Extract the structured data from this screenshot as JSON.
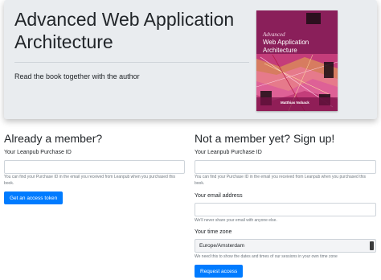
{
  "hero": {
    "title": "Advanced Web Application Architecture",
    "lead": "Read the book together with the author"
  },
  "cover": {
    "title_line1": "Advanced",
    "title_line2": "Web Application",
    "title_line3": "Architecture",
    "author": "Matthias Noback",
    "colors": {
      "base": "#7e1e52",
      "accent": "#e8b04a"
    }
  },
  "member": {
    "heading": "Already a member?",
    "purchase_label": "Your Leanpub Purchase ID",
    "purchase_value": "",
    "purchase_help": "You can find your Purchase ID in the email you received from Leanpub when you purchased this book.",
    "submit_label": "Get an access token"
  },
  "signup": {
    "heading": "Not a member yet? Sign up!",
    "purchase_label": "Your Leanpub Purchase ID",
    "purchase_value": "",
    "purchase_help": "You can find your Purchase ID in the email you received from Leanpub when you purchased this book.",
    "email_label": "Your email address",
    "email_value": "",
    "email_help": "We'll never share your email with anyone else.",
    "timezone_label": "Your time zone",
    "timezone_value": "Europe/Amsterdam",
    "timezone_help": "We need this to show the dates and times of our sessions in your own time zone",
    "submit_label": "Request access"
  },
  "colors": {
    "primary": "#007bff",
    "jumbotron": "#e9ecef"
  }
}
